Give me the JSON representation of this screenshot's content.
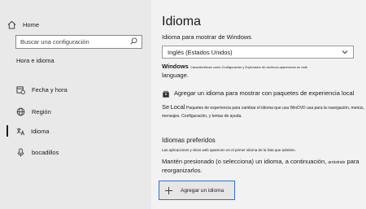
{
  "sidebar": {
    "home_label": "Home",
    "search_placeholder": "Buscar una configuración",
    "section_label": "Hora e idioma",
    "items": [
      {
        "label": "Fecha y hora",
        "icon": "calendar-clock-icon"
      },
      {
        "label": "Región",
        "icon": "globe-icon"
      },
      {
        "label": "Idioma",
        "icon": "language-icon",
        "active": true
      },
      {
        "label": "bocadillos",
        "icon": "microphone-icon"
      }
    ]
  },
  "main": {
    "title": "Idioma",
    "display_language_label": "Idioma para mostrar de Windows",
    "display_language_value": "Inglés (Estados Unidos)",
    "windows_note_bold": "Windows",
    "windows_note_small": "Características como Configuración y Explorador de archivos aparecerán en este",
    "windows_note_end": "language.",
    "add_local_text": "Agregar un idioma para mostrar con paquetes de experiencia local",
    "local_desc_se": "Se",
    "local_desc_local": "Local",
    "local_desc_rest": "Paquetes de experiencia para cambiar el idioma que usa WinDVD usa para la navegación, menús, mensajes. Configuración, y temas de ayuda.",
    "preferred_title": "Idiomas preferidos",
    "preferred_desc": "Las aplicaciones y sitios web aparecen en el primer idioma de la lista que admiten.",
    "preferred_hint_a": "Mantén presionado (o selecciona) un idioma, a continuación,",
    "preferred_hint_small": "arrástralo",
    "preferred_hint_b": "para reorganizarlos.",
    "add_language_label": "Agregar un idioma"
  },
  "colors": {
    "sidebar_bg": "#e9e9e9",
    "main_bg": "#f2f2f2",
    "focus_border": "#2f6fd6"
  }
}
